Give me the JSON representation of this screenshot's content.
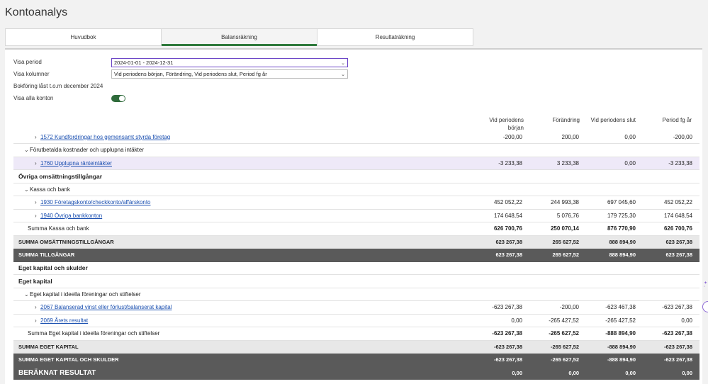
{
  "page": {
    "title": "Kontoanalys"
  },
  "tabs": [
    "Huvudbok",
    "Balansräkning",
    "Resultaträkning"
  ],
  "filters": {
    "period_label": "Visa period",
    "period_value": "2024-01-01 - 2024-12-31",
    "columns_label": "Visa kolumner",
    "columns_value": "Vid periodens början, Förändring, Vid periodens slut, Period fg år",
    "locked_text": "Bokföring låst t.o.m december 2024",
    "show_all_label": "Visa alla konton"
  },
  "columns": {
    "c1_line1": "Vid periodens",
    "c1_line2": "början",
    "c2": "Förändring",
    "c3": "Vid periodens slut",
    "c4": "Period fg år"
  },
  "rows": [
    {
      "name": "1572 Kundfordringar hos gemensamt styrda företag",
      "v1": "-200,00",
      "v2": "200,00",
      "v3": "0,00",
      "v4": "-200,00"
    },
    {
      "name": "Förutbetalda kostnader och upplupna intäkter"
    },
    {
      "name": "1760 Upplupna ränteintäkter",
      "v1": "-3 233,38",
      "v2": "3 233,38",
      "v3": "0,00",
      "v4": "-3 233,38"
    },
    {
      "name": "Övriga omsättningstillgångar"
    },
    {
      "name": "Kassa och bank"
    },
    {
      "name": "1930 Företagskonto/checkkonto/affärskonto",
      "v1": "452 052,22",
      "v2": "244 993,38",
      "v3": "697 045,60",
      "v4": "452 052,22"
    },
    {
      "name": "1940 Övriga bankkonton",
      "v1": "174 648,54",
      "v2": "5 076,76",
      "v3": "179 725,30",
      "v4": "174 648,54"
    },
    {
      "name": "Summa Kassa och bank",
      "v1": "626 700,76",
      "v2": "250 070,14",
      "v3": "876 770,90",
      "v4": "626 700,76"
    },
    {
      "name": "SUMMA OMSÄTTNINGSTILLGÅNGAR",
      "v1": "623 267,38",
      "v2": "265 627,52",
      "v3": "888 894,90",
      "v4": "623 267,38"
    },
    {
      "name": "SUMMA TILLGÅNGAR",
      "v1": "623 267,38",
      "v2": "265 627,52",
      "v3": "888 894,90",
      "v4": "623 267,38"
    },
    {
      "name": "Eget kapital och skulder"
    },
    {
      "name": "Eget kapital"
    },
    {
      "name": "Eget kapital i ideella föreningar och stiftelser"
    },
    {
      "name": "2067 Balanserad vinst eller förlust/balanserat kapital",
      "v1": "-623 267,38",
      "v2": "-200,00",
      "v3": "-623 467,38",
      "v4": "-623 267,38"
    },
    {
      "name": "2069 Årets resultat",
      "v1": "0,00",
      "v2": "-265 427,52",
      "v3": "-265 427,52",
      "v4": "0,00"
    },
    {
      "name": "Summa Eget kapital i ideella föreningar och stiftelser",
      "v1": "-623 267,38",
      "v2": "-265 627,52",
      "v3": "-888 894,90",
      "v4": "-623 267,38"
    },
    {
      "name": "SUMMA EGET KAPITAL",
      "v1": "-623 267,38",
      "v2": "-265 627,52",
      "v3": "-888 894,90",
      "v4": "-623 267,38"
    },
    {
      "name": "SUMMA EGET KAPITAL OCH SKULDER",
      "v1": "-623 267,38",
      "v2": "-265 627,52",
      "v3": "-888 894,90",
      "v4": "-623 267,38"
    },
    {
      "name": "BERÄKNAT RESULTAT",
      "v1": "0,00",
      "v2": "0,00",
      "v3": "0,00",
      "v4": "0,00"
    }
  ],
  "colors": {
    "accent": "#2f7a3c",
    "focus": "#6b45c6",
    "link": "#1a4fb0",
    "dark_row": "#5a5a5a",
    "highlight_row": "#eee9f8"
  }
}
